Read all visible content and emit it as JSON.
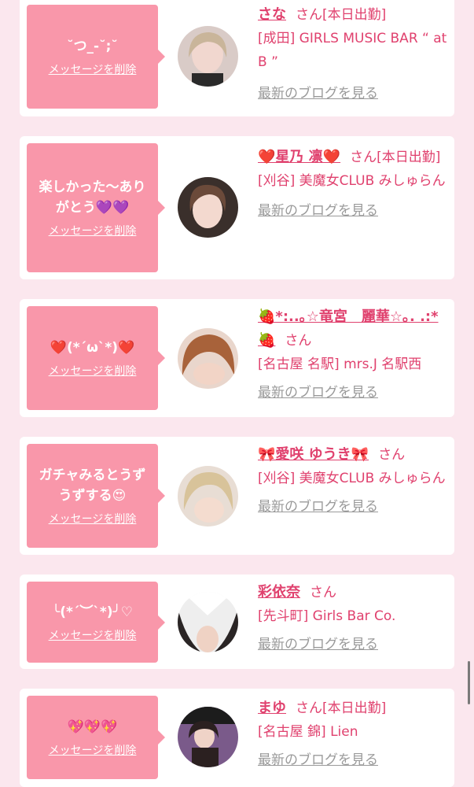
{
  "colors": {
    "background": "#fbe7ee",
    "bubble": "#f997aa",
    "accent": "#e0416e",
    "muted": "#9a9a9a"
  },
  "delete_label": "メッセージを削除",
  "san_label": "さん",
  "blog_label": "最新のブログを見る",
  "cards": [
    {
      "message": "˘つ_-˘;˘",
      "name": "さな",
      "status": "[本日出勤]",
      "shop": "[成田] GIRLS MUSIC BAR “ at B ”"
    },
    {
      "message": "楽しかった〜ありがとう💜💜",
      "name": "❤️星乃 凛❤️",
      "status": "[本日出勤]",
      "shop": "[刈谷] 美魔女CLUB みしゅらん"
    },
    {
      "message": "❤️(*´ω`*)❤️",
      "name": "🍓*:..｡☆竜宮　麗華☆｡. .:*🍓",
      "status": "",
      "shop": "[名古屋 名駅] mrs.J 名駅西"
    },
    {
      "message": "ガチャみるとうずうずする😍",
      "name": "🎀愛咲 ゆうき🎀",
      "status": "",
      "shop": "[刈谷] 美魔女CLUB みしゅらん"
    },
    {
      "message": "╰(*´︶`*)╯♡",
      "name": "彩依奈",
      "status": "",
      "shop": "[先斗町] Girls Bar Co."
    },
    {
      "message": "💖💖💖",
      "name": "まゆ",
      "status": "[本日出勤]",
      "shop": "[名古屋 錦] Lien"
    }
  ]
}
